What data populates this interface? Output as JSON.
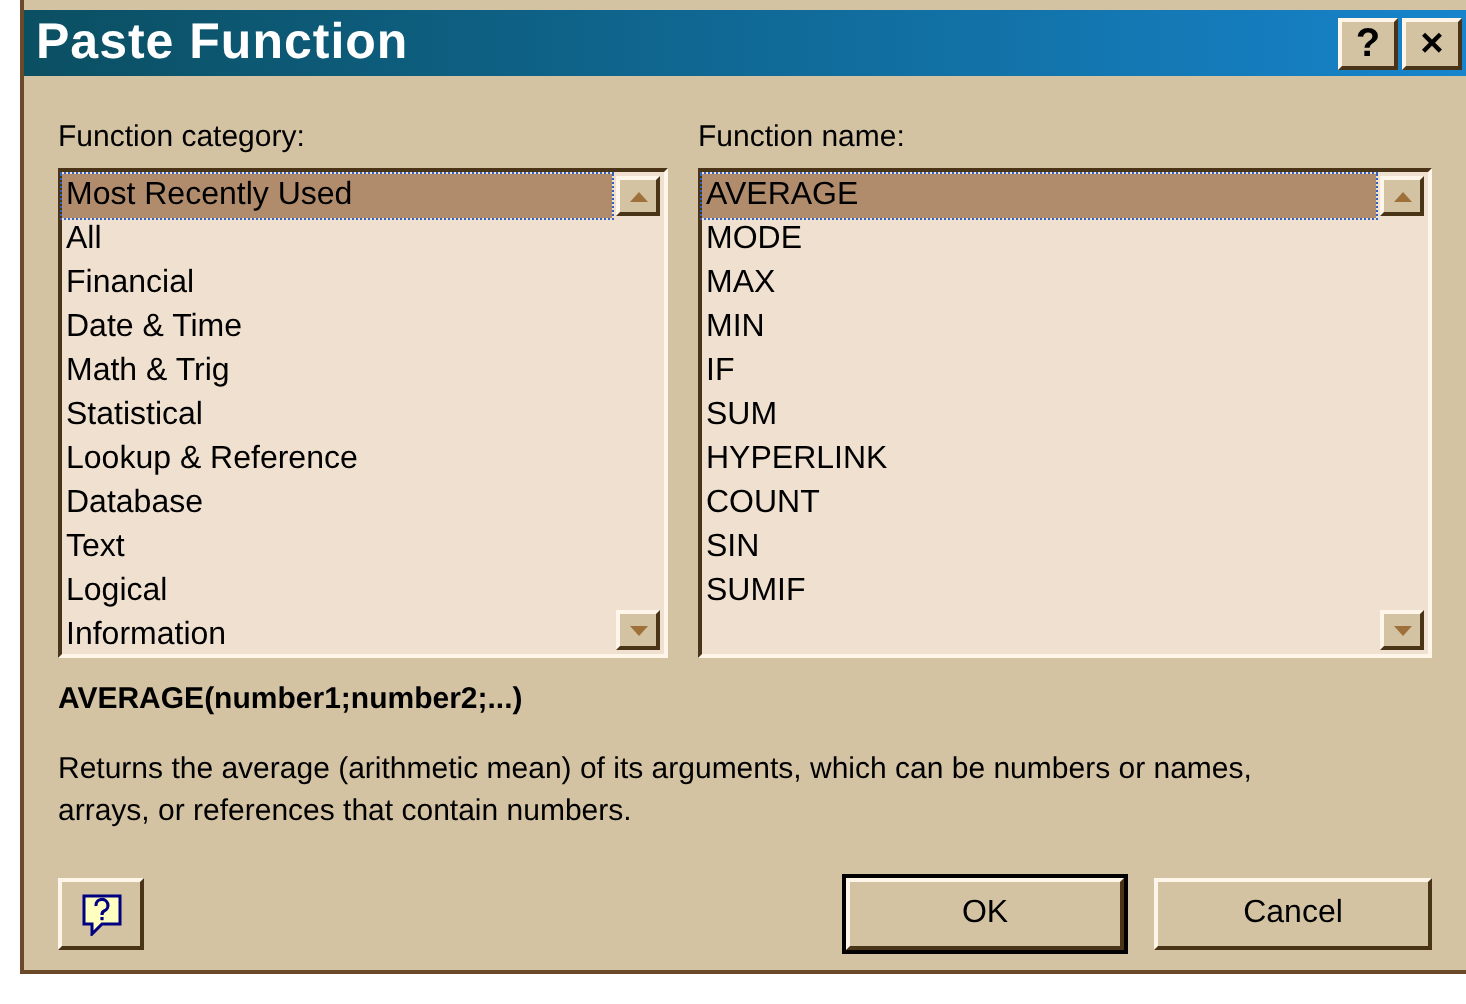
{
  "window": {
    "title": "Paste Function",
    "title_buttons": [
      "?",
      "×"
    ]
  },
  "category_list": {
    "label": "Function category:",
    "items": [
      {
        "label": "Most Recently Used",
        "selected": true
      },
      {
        "label": "All",
        "selected": false
      },
      {
        "label": "Financial",
        "selected": false
      },
      {
        "label": "Date & Time",
        "selected": false
      },
      {
        "label": "Math & Trig",
        "selected": false
      },
      {
        "label": "Statistical",
        "selected": false
      },
      {
        "label": "Lookup & Reference",
        "selected": false
      },
      {
        "label": "Database",
        "selected": false
      },
      {
        "label": "Text",
        "selected": false
      },
      {
        "label": "Logical",
        "selected": false
      },
      {
        "label": "Information",
        "selected": false
      }
    ]
  },
  "function_list": {
    "label": "Function name:",
    "items": [
      {
        "label": "AVERAGE",
        "selected": true
      },
      {
        "label": "MODE",
        "selected": false
      },
      {
        "label": "MAX",
        "selected": false
      },
      {
        "label": "MIN",
        "selected": false
      },
      {
        "label": "IF",
        "selected": false
      },
      {
        "label": "SUM",
        "selected": false
      },
      {
        "label": "HYPERLINK",
        "selected": false
      },
      {
        "label": "COUNT",
        "selected": false
      },
      {
        "label": "SIN",
        "selected": false
      },
      {
        "label": "SUMIF",
        "selected": false
      }
    ]
  },
  "syntax": "AVERAGE(number1;number2;...)",
  "description": "Returns the average (arithmetic mean) of its arguments, which can be numbers or names, arrays, or references that contain numbers.",
  "buttons": [
    {
      "label": "OK",
      "default": true
    },
    {
      "label": "Cancel",
      "default": false
    }
  ]
}
